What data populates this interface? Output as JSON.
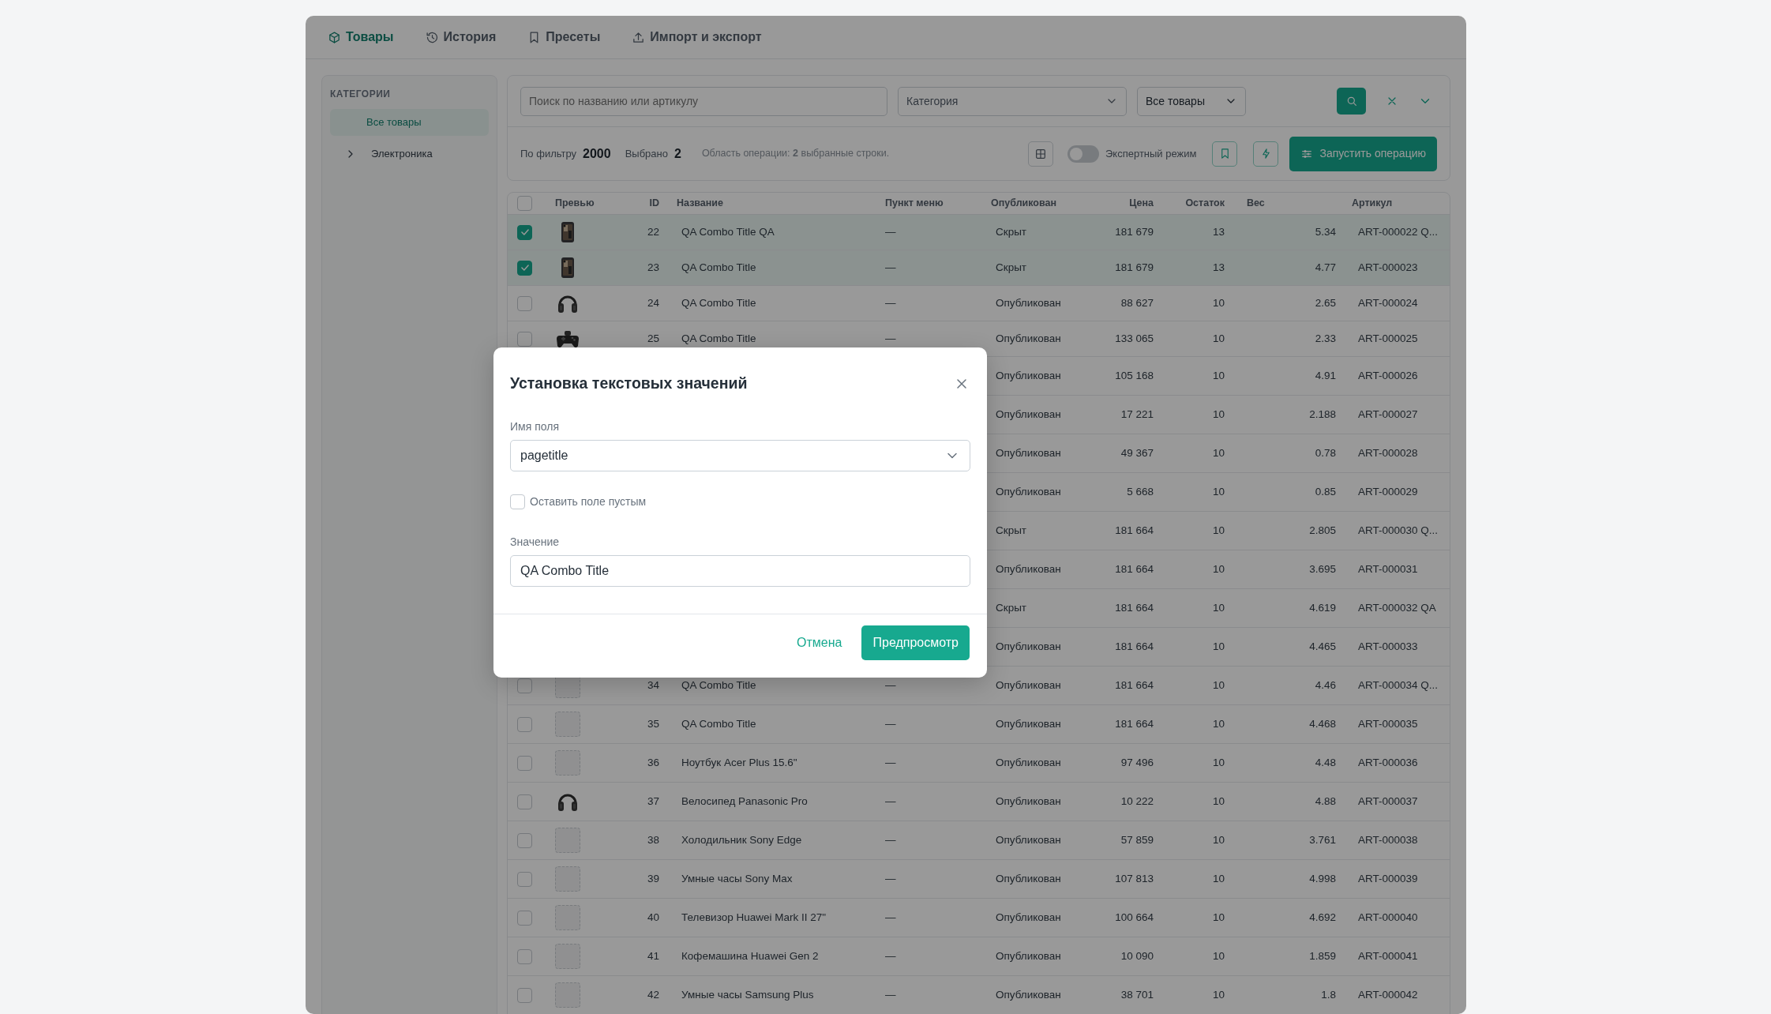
{
  "tabs": [
    {
      "label": "Товары",
      "selected": true
    },
    {
      "label": "История",
      "selected": false
    },
    {
      "label": "Пресеты",
      "selected": false
    },
    {
      "label": "Импорт и экспорт",
      "selected": false
    }
  ],
  "sidebar": {
    "title": "КАТЕГОРИИ",
    "items": [
      {
        "label": "Все товары",
        "selected": true,
        "expandable": false
      },
      {
        "label": "Электроника",
        "selected": false,
        "expandable": true
      }
    ]
  },
  "filters": {
    "search": {
      "placeholder": "Поиск по названию или артикулу"
    },
    "category": {
      "placeholder": "Категория"
    },
    "scope": {
      "value": "Все товары"
    }
  },
  "stats": {
    "filtered_label": "По фильтру",
    "filtered": "2000",
    "selected_label": "Выбрано",
    "selected": "2",
    "scope_text": "Область операции: **2** выбранные строки.",
    "expert_mode": {
      "label": "Экспертный режим",
      "on": false
    },
    "run_button": "Запустить операцию"
  },
  "table": {
    "all_selected": false,
    "columns": [
      "Превью",
      "ID",
      "Название",
      "Пункт меню",
      "Опубликован",
      "Цена",
      "Остаток",
      "Вес",
      "Артикул"
    ],
    "rows": [
      {
        "selected": true,
        "id": "22",
        "name": "QA Combo Title QA",
        "menu": "—",
        "status": "Скрыт",
        "price": "181 679",
        "stock": "13",
        "weight": "5.34",
        "sku": "ART-000022 Q..."
      },
      {
        "selected": true,
        "id": "23",
        "name": "QA Combo Title",
        "menu": "—",
        "status": "Скрыт",
        "price": "181 679",
        "stock": "13",
        "weight": "4.77",
        "sku": "ART-000023"
      },
      {
        "selected": false,
        "id": "24",
        "name": "QA Combo Title",
        "menu": "—",
        "status": "Опубликован",
        "price": "88 627",
        "stock": "10",
        "weight": "2.65",
        "sku": "ART-000024"
      },
      {
        "selected": false,
        "id": "25",
        "name": "QA Combo Title",
        "menu": "—",
        "status": "Опубликован",
        "price": "133 065",
        "stock": "10",
        "weight": "2.33",
        "sku": "ART-000025"
      },
      {
        "status": "Опубликован",
        "price": "105 168",
        "stock": "10",
        "weight": "4.91",
        "sku": "ART-000026"
      },
      {
        "status": "Опубликован",
        "price": "17 221",
        "stock": "10",
        "weight": "2.188",
        "sku": "ART-000027"
      },
      {
        "status": "Опубликован",
        "price": "49 367",
        "stock": "10",
        "weight": "0.78",
        "sku": "ART-000028"
      },
      {
        "status": "Опубликован",
        "price": "5 668",
        "stock": "10",
        "weight": "0.85",
        "sku": "ART-000029"
      },
      {
        "status": "Скрыт",
        "price": "181 664",
        "stock": "10",
        "weight": "2.805",
        "sku": "ART-000030 Q..."
      },
      {
        "status": "Опубликован",
        "price": "181 664",
        "stock": "10",
        "weight": "3.695",
        "sku": "ART-000031"
      },
      {
        "status": "Скрыт",
        "price": "181 664",
        "stock": "10",
        "weight": "4.619",
        "sku": "ART-000032 QA"
      },
      {
        "status": "Опубликован",
        "price": "181 664",
        "stock": "10",
        "weight": "4.465",
        "sku": "ART-000033"
      },
      {
        "selected": false,
        "preview": {
          "kind": "placeholder"
        },
        "id": "34",
        "name": "QA Combo Title",
        "menu": "—",
        "status": "Опубликован",
        "price": "181 664",
        "stock": "10",
        "weight": "4.46",
        "sku": "ART-000034 Q..."
      },
      {
        "selected": false,
        "preview": {
          "kind": "placeholder"
        },
        "id": "35",
        "name": "QA Combo Title",
        "menu": "—",
        "status": "Опубликован",
        "price": "181 664",
        "stock": "10",
        "weight": "4.468",
        "sku": "ART-000035"
      },
      {
        "selected": false,
        "preview": {
          "kind": "placeholder"
        },
        "id": "36",
        "name": "Ноутбук Acer Plus 15.6\"",
        "menu": "—",
        "status": "Опубликован",
        "price": "97 496",
        "stock": "10",
        "weight": "4.48",
        "sku": "ART-000036"
      },
      {
        "selected": false,
        "id": "37",
        "name": "Велосипед Panasonic Pro",
        "menu": "—",
        "status": "Опубликован",
        "price": "10 222",
        "stock": "10",
        "weight": "4.88",
        "sku": "ART-000037"
      },
      {
        "selected": false,
        "preview": {
          "kind": "placeholder"
        },
        "id": "38",
        "name": "Холодильник Sony Edge",
        "menu": "—",
        "status": "Опубликован",
        "price": "57 859",
        "stock": "10",
        "weight": "3.761",
        "sku": "ART-000038"
      },
      {
        "selected": false,
        "preview": {
          "kind": "placeholder"
        },
        "id": "39",
        "name": "Умные часы Sony Max",
        "menu": "—",
        "status": "Опубликован",
        "price": "107 813",
        "stock": "10",
        "weight": "4.998",
        "sku": "ART-000039"
      },
      {
        "selected": false,
        "preview": {
          "kind": "placeholder"
        },
        "id": "40",
        "name": "Телевизор Huawei Mark II 27\"",
        "menu": "—",
        "status": "Опубликован",
        "price": "100 664",
        "stock": "10",
        "weight": "4.692",
        "sku": "ART-000040"
      },
      {
        "selected": false,
        "preview": {
          "kind": "placeholder"
        },
        "id": "41",
        "name": "Кофемашина Huawei Gen 2",
        "menu": "—",
        "status": "Опубликован",
        "price": "10 090",
        "stock": "10",
        "weight": "1.859",
        "sku": "ART-000041"
      },
      {
        "selected": false,
        "preview": {
          "kind": "placeholder"
        },
        "id": "42",
        "name": "Умные часы Samsung Plus",
        "menu": "—",
        "status": "Опубликован",
        "price": "38 701",
        "stock": "10",
        "weight": "1.8",
        "sku": "ART-000042"
      }
    ]
  },
  "modal": {
    "title": "Установка текстовых значений",
    "field_label": "Имя поля",
    "field_value": "pagetitle",
    "empty_checkbox": {
      "label": "Оставить поле пустым",
      "checked": false
    },
    "value_label": "Значение",
    "value": "QA Combo Title",
    "cancel": "Отмена",
    "preview": "Предпросмотр"
  }
}
